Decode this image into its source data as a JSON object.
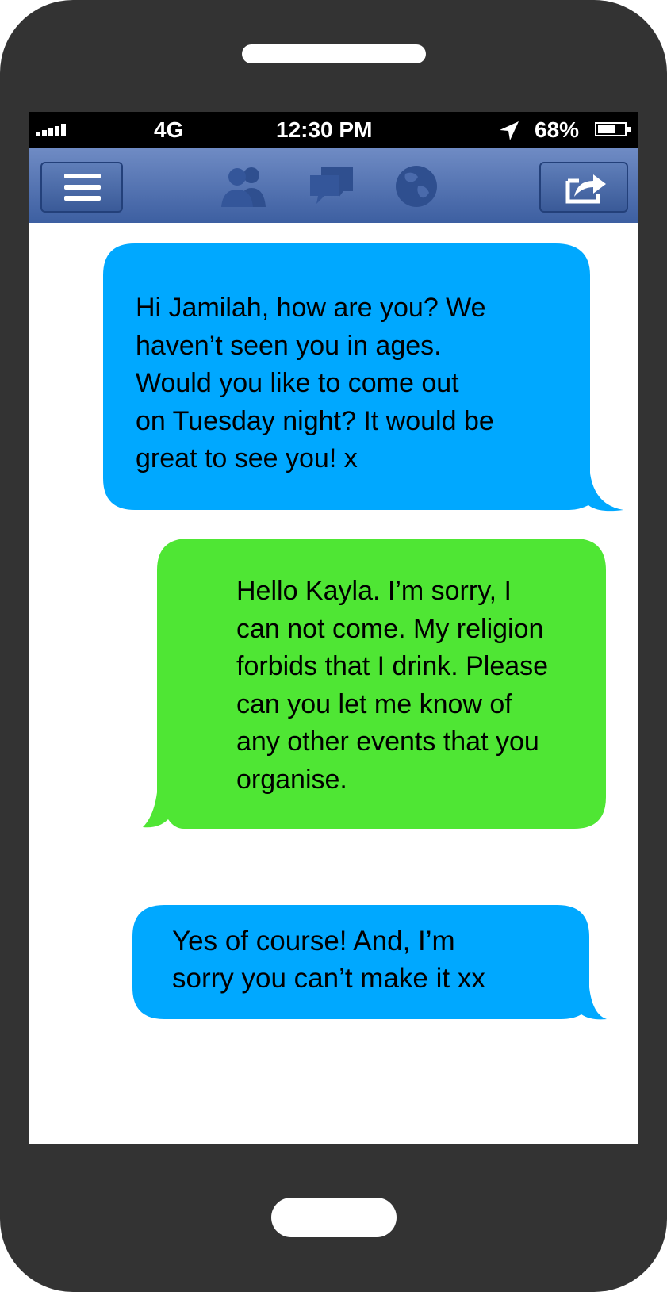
{
  "status_bar": {
    "network": "4G",
    "time": "12:30 PM",
    "battery_percent": "68%",
    "battery_level": 0.68,
    "signal_bars": 5
  },
  "nav_bar": {
    "icons": [
      "menu-icon",
      "friends-icon",
      "chat-icon",
      "globe-icon",
      "share-icon"
    ]
  },
  "messages": [
    {
      "sender": "other",
      "color": "#00a8ff",
      "text": "Hi Jamilah, how are you? We\nhaven’t seen you in ages.\nWould you like to come out\non Tuesday night? It would be\ngreat to see you! x"
    },
    {
      "sender": "me",
      "color": "#4fe634",
      "text": "Hello Kayla. I’m sorry, I\ncan not come. My religion\nforbids that I drink. Please\ncan you let me know of\nany other events that you\norganise."
    },
    {
      "sender": "other",
      "color": "#00a8ff",
      "text": "Yes of course! And, I’m\nsorry you can’t make it xx"
    }
  ]
}
